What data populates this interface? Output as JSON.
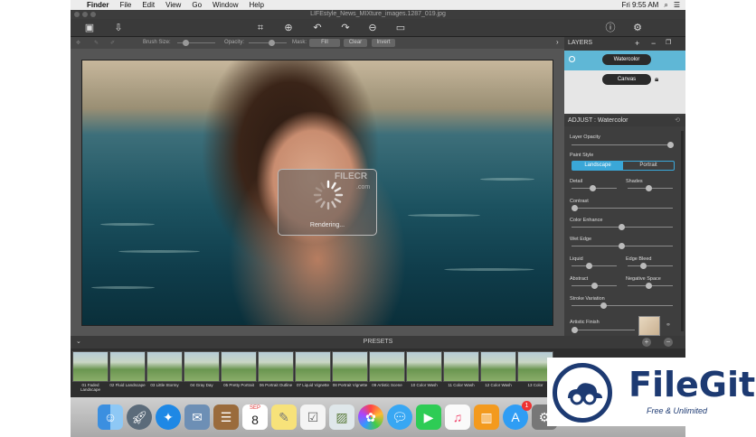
{
  "menubar": {
    "apple": "",
    "app": "Finder",
    "items": [
      "File",
      "Edit",
      "View",
      "Go",
      "Window",
      "Help"
    ],
    "clock": "Fri 9:55 AM"
  },
  "window": {
    "title": "LIFEstyle_News_MIXture_images.1287_019.jpg"
  },
  "options": {
    "brush_size": "Brush Size:",
    "opacity": "Opacity:",
    "mask": "Mask:",
    "fill": "Fill",
    "clear": "Clear",
    "invert": "Invert"
  },
  "watermark": {
    "line1": "FILECR",
    ".com": ".com"
  },
  "rendering": {
    "label": "Rendering..."
  },
  "layers": {
    "title": "LAYERS",
    "items": [
      "Watercolor",
      "Canvas"
    ]
  },
  "adjust": {
    "title": "ADJUST : Watercolor",
    "layer_opacity": "Layer Opacity",
    "paint_style": "Paint Style",
    "styles": [
      "Landscape",
      "Portrait"
    ],
    "detail": "Detail",
    "shades": "Shades",
    "contrast": "Contrast",
    "color_enhance": "Color Enhance",
    "wet_edge": "Wet Edge",
    "liquid": "Liquid",
    "edge_bleed": "Edge Bleed",
    "abstract": "Abstract",
    "negative_space": "Negative Space",
    "stroke_variation": "Stroke Variation",
    "artistic_finish": "Artistic Finish"
  },
  "presets": {
    "title": "PRESETS",
    "items": [
      "01 Faded Landscape",
      "02 Fluid Landscape",
      "03 Little Stormy",
      "04 Gray Day",
      "05 Pretty Portrait",
      "06 Portrait Outline",
      "07 Liquid Vignette",
      "08 Portrait Vignette",
      "09 Artistic Scene",
      "10 Color Wash",
      "11 Color Wash",
      "12 Color Wash",
      "13 Color"
    ]
  },
  "dock": {
    "calendar_month": "SEP",
    "calendar_day": "8",
    "appstore_badge": "1"
  },
  "filegit": {
    "title": "FileGit",
    "subtitle": "Free & Unlimited"
  },
  "colors": {
    "accent": "#3aa7d8",
    "layer_selected": "#5fb7d6",
    "logo": "#1d3a72"
  }
}
